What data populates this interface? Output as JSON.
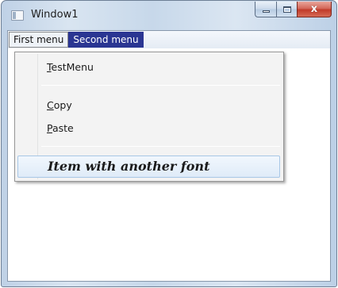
{
  "window": {
    "title": "Window1",
    "caption_buttons": {
      "minimize_icon": "minimize-icon",
      "maximize_icon": "maximize-icon",
      "close_icon": "close-icon",
      "close_glyph": "x"
    }
  },
  "menubar": {
    "items": [
      {
        "label": "First menu"
      },
      {
        "label": "Second menu"
      }
    ]
  },
  "dropdown": {
    "items": [
      {
        "access_key": "T",
        "rest": "estMenu"
      },
      {
        "access_key": "C",
        "rest": "opy"
      },
      {
        "access_key": "P",
        "rest": "aste"
      }
    ],
    "special_item": {
      "label": "Item with another font"
    }
  },
  "colors": {
    "menu_highlight": "#2a3592",
    "hover_border": "#a8c7e6"
  }
}
